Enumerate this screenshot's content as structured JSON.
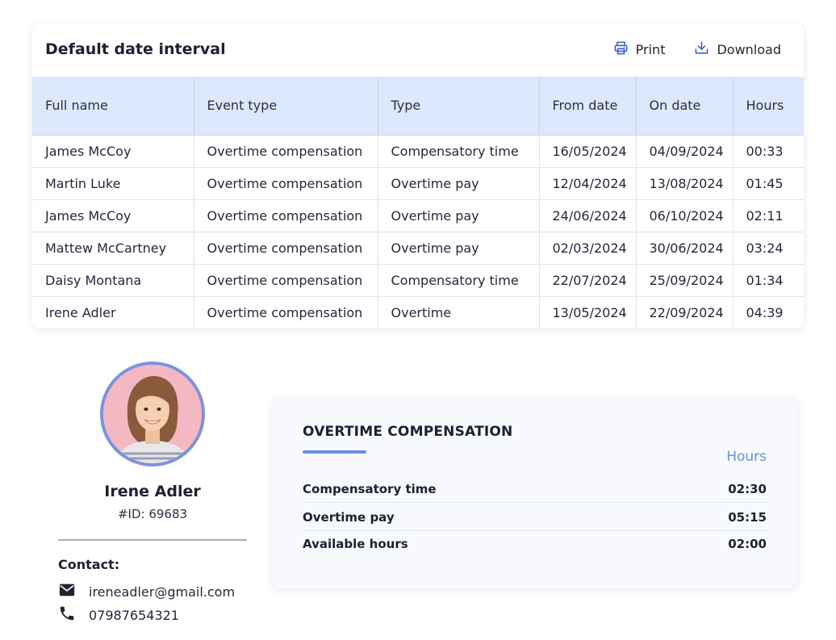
{
  "report": {
    "title": "Default date interval",
    "actions": {
      "print_label": "Print",
      "download_label": "Download"
    },
    "columns": [
      "Full name",
      "Event type",
      "Type",
      "From date",
      "On date",
      "Hours"
    ],
    "rows": [
      [
        "James  McCoy",
        "Overtime compensation",
        "Compensatory time",
        "16/05/2024",
        "04/09/2024",
        "00:33"
      ],
      [
        "Martin Luke",
        "Overtime compensation",
        "Overtime pay",
        "12/04/2024",
        "13/08/2024",
        "01:45"
      ],
      [
        "James  McCoy",
        "Overtime compensation",
        "Overtime pay",
        "24/06/2024",
        "06/10/2024",
        "02:11"
      ],
      [
        "Mattew McCartney",
        "Overtime compensation",
        "Overtime pay",
        "02/03/2024",
        "30/06/2024",
        "03:24"
      ],
      [
        "Daisy Montana",
        "Overtime compensation",
        "Compensatory time",
        "22/07/2024",
        "25/09/2024",
        "01:34"
      ],
      [
        "Irene Adler",
        "Overtime compensation",
        "Overtime",
        "13/05/2024",
        "22/09/2024",
        "04:39"
      ]
    ]
  },
  "profile": {
    "name": "Irene Adler",
    "id_label": "#ID: 69683",
    "contact_label": "Contact:",
    "email": "ireneadler@gmail.com",
    "phone": "07987654321",
    "email_icon": "mail-icon",
    "phone_icon": "phone-icon"
  },
  "overtime": {
    "title": "OVERTIME COMPENSATION",
    "hours_header": "Hours",
    "items": [
      {
        "label": "Compensatory time",
        "value": "02:30"
      },
      {
        "label": "Overtime pay",
        "value": "05:15"
      },
      {
        "label": "Available hours",
        "value": "02:00"
      }
    ]
  },
  "colors": {
    "accent": "#6f8ee0",
    "table_header_bg": "#dde8fd",
    "avatar_bg": "#f3b8c2"
  }
}
